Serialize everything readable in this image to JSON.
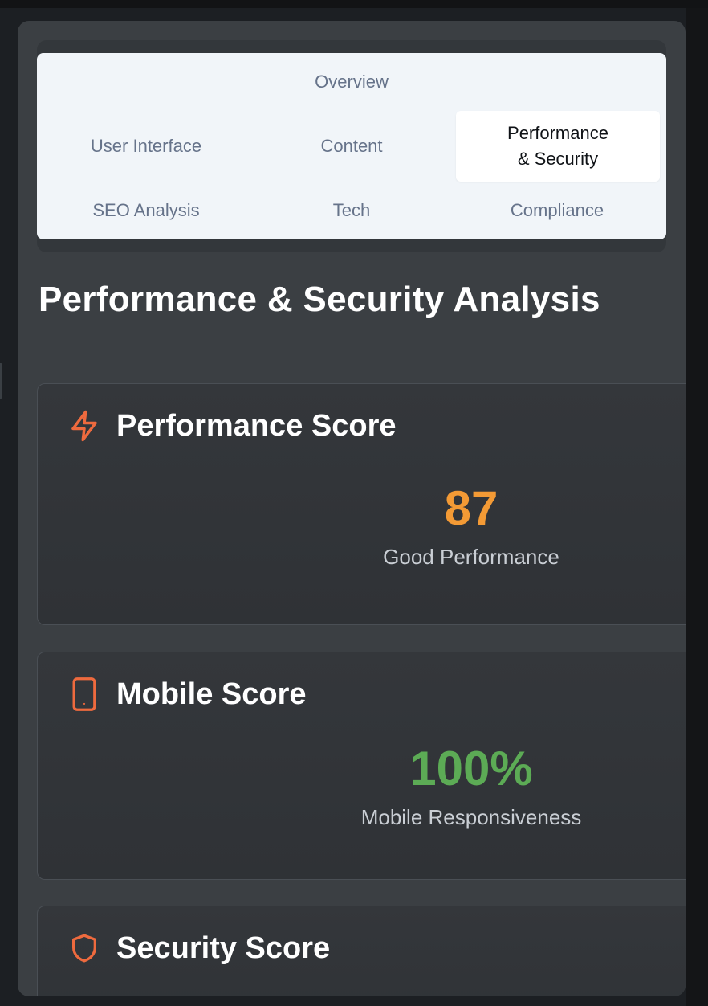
{
  "tabs": {
    "overview": "Overview",
    "user_interface": "User Interface",
    "content": "Content",
    "performance_security": "Performance & Security",
    "seo_analysis": "SEO Analysis",
    "tech": "Tech",
    "compliance": "Compliance",
    "active": "Performance & Security"
  },
  "page_title": "Performance & Security Analysis",
  "cards": {
    "performance": {
      "icon": "lightning-icon",
      "title": "Performance Score",
      "value": "87",
      "label": "Good Performance",
      "value_color": "#f39a35"
    },
    "mobile": {
      "icon": "phone-icon",
      "title": "Mobile Score",
      "value": "100%",
      "label": "Mobile Responsiveness",
      "value_color": "#5cab55"
    },
    "security": {
      "icon": "shield-icon",
      "title": "Security Score"
    }
  },
  "colors": {
    "accent_icon": "#ee6a3e",
    "panel_bg": "#3b3f43",
    "tab_bg": "#f1f5f9"
  }
}
